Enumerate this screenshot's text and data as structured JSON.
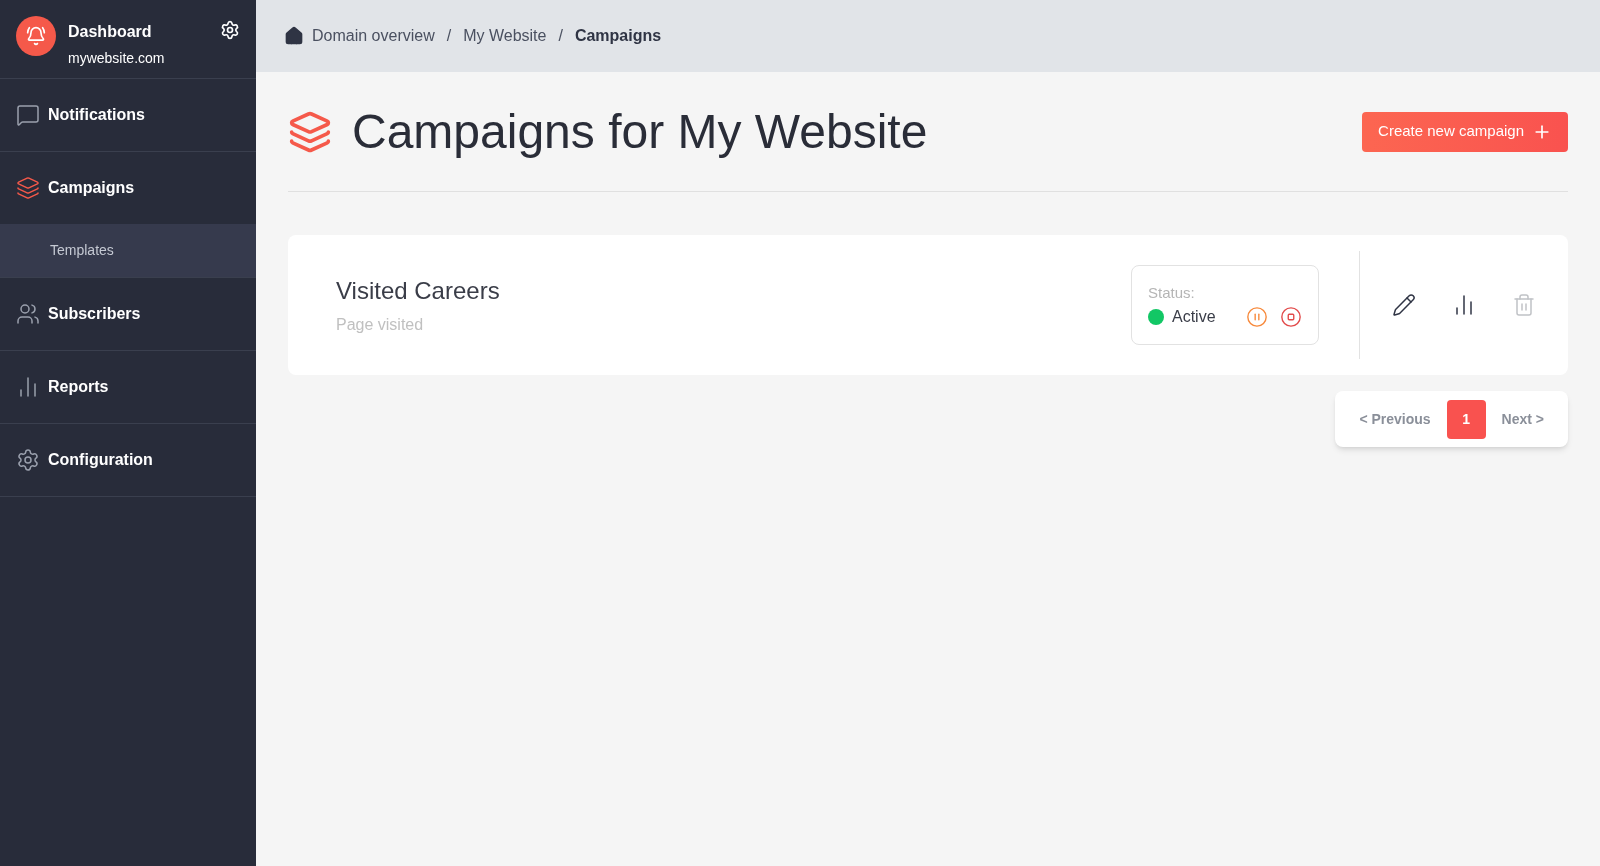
{
  "brand": {
    "title": "Dashboard",
    "subtitle": "mywebsite.com"
  },
  "sidebar": {
    "items": [
      {
        "kind": "notifications",
        "label": "Notifications",
        "selected": false
      },
      {
        "kind": "campaigns",
        "label": "Campaigns",
        "selected": true,
        "children": [
          {
            "label": "Templates",
            "selected": true
          }
        ]
      },
      {
        "kind": "subscribers",
        "label": "Subscribers",
        "selected": false
      },
      {
        "kind": "reports",
        "label": "Reports",
        "selected": false
      },
      {
        "kind": "configuration",
        "label": "Configuration",
        "selected": false
      }
    ]
  },
  "breadcrumbs": [
    {
      "kind": "link",
      "text": "Domain overview"
    },
    {
      "kind": "separator",
      "text": "/"
    },
    {
      "kind": "link",
      "text": "My Website"
    },
    {
      "kind": "separator",
      "text": "/"
    },
    {
      "kind": "current",
      "text": "Campaigns"
    }
  ],
  "page_title": "Campaigns for My Website",
  "create_button": "Create new campaign",
  "campaigns": [
    {
      "name": "Visited Careers",
      "trigger": "Page visited",
      "status_label": "Status:",
      "status": "Active",
      "color": "#12c765",
      "actions": [
        {
          "kind": "edit",
          "disabled": false
        },
        {
          "kind": "stats",
          "disabled": false
        },
        {
          "kind": "delete",
          "disabled": true
        }
      ]
    }
  ],
  "pagination": {
    "previous": "< Previous",
    "pages": [
      {
        "label": "1",
        "selected": true
      }
    ],
    "next": "Next >"
  }
}
